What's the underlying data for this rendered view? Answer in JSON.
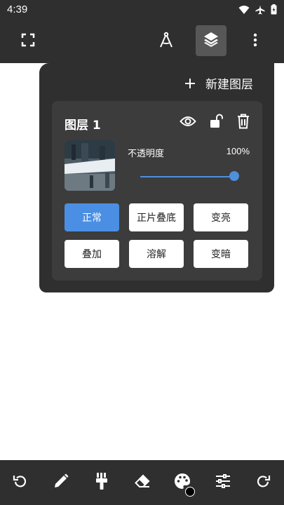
{
  "status": {
    "time": "4:39"
  },
  "panel": {
    "new_layer_label": "新建图层",
    "layer": {
      "name": "图层 1",
      "opacity_label": "不透明度",
      "opacity_value": "100%",
      "opacity_fraction": 1.0
    },
    "blend_modes": [
      {
        "label": "正常",
        "selected": true
      },
      {
        "label": "正片叠底",
        "selected": false
      },
      {
        "label": "变亮",
        "selected": false
      },
      {
        "label": "叠加",
        "selected": false
      },
      {
        "label": "溶解",
        "selected": false
      },
      {
        "label": "变暗",
        "selected": false
      }
    ]
  },
  "toolbar_icons": [
    "fullscreen-icon",
    "compass-icon",
    "layers-icon",
    "more-vert-icon"
  ],
  "bottom_icons": [
    "undo-icon",
    "pencil-icon",
    "brush-icon",
    "eraser-icon",
    "palette-icon",
    "sliders-icon",
    "redo-icon"
  ],
  "colors": {
    "accent": "#4a8fe3",
    "bar": "#2f2f2f",
    "card": "#3c3c3c"
  }
}
